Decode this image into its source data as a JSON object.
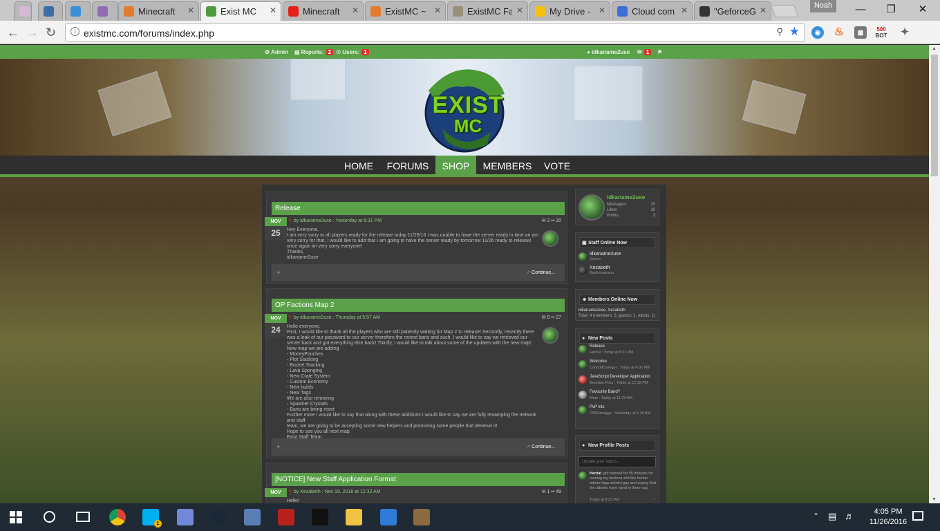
{
  "browser": {
    "tabs": [
      {
        "label": "",
        "icon": "pin-icon",
        "color": "#d7b7d6"
      },
      {
        "label": "",
        "icon": "w-icon",
        "color": "#3d6ea6"
      },
      {
        "label": "",
        "icon": "hex-icon",
        "color": "#3d8fd6"
      },
      {
        "label": "",
        "icon": "mail-icon",
        "color": "#8f6bb4"
      },
      {
        "label": "Minecraft",
        "icon": "m-icon",
        "color": "#e37b2f"
      },
      {
        "label": "Exist MC",
        "icon": "exist-icon",
        "color": "#4f9a3d"
      },
      {
        "label": "Minecraft",
        "icon": "youtube-icon",
        "color": "#e62117"
      },
      {
        "label": "ExistMC ~",
        "icon": "m-icon",
        "color": "#e37b2f"
      },
      {
        "label": "ExistMC Fa",
        "icon": "mcs-icon",
        "color": "#9a8f78"
      },
      {
        "label": "My Drive -",
        "icon": "drive-icon",
        "color": "#f4c20d"
      },
      {
        "label": "Cloud com",
        "icon": "cloud-icon",
        "color": "#3a6fd8"
      },
      {
        "label": "\"GeforceG",
        "icon": "n-icon",
        "color": "#333333"
      }
    ],
    "profile_name": "Noah",
    "url": "existmc.com/forums/index.php"
  },
  "site": {
    "adminbar": {
      "admin": "Admin",
      "reports": "Reports:",
      "reports_count": "2",
      "users": "Users:",
      "users_count": "1",
      "username": "idkaname2use",
      "inbox_count": "1"
    },
    "logo_text_1": "EXIST",
    "logo_text_2": "MC",
    "nav": [
      "HOME",
      "FORUMS",
      "SHOP",
      "MEMBERS",
      "VOTE"
    ],
    "nav_active": "SHOP",
    "threads": [
      {
        "title": "Release",
        "month": "NOV",
        "day": "25",
        "author_line": "by idkaname2use : Yesterday at 8:31 PM",
        "replies": "2",
        "views": "20",
        "body": [
          "Hey Everyone,",
          "I am very sorry to all players ready for the release today 11/25/16 I was unable to have the server ready in time an am",
          "very sorry for that, I would like to add that I am going to have the server ready by tomorrow 11/26 ready to release!",
          "once again im very sorry everyone!",
          "Thanks,",
          "idkaname2use"
        ],
        "continue": "Continue..."
      },
      {
        "title": "OP Factions Map 2",
        "month": "NOV",
        "day": "24",
        "author_line": "by idkaname2use : Thursday at 5:57 AM",
        "replies": "0",
        "views": "27",
        "body": [
          "Hello everyone,",
          "First, I would like to thank all the players who are still patiently waiting for Map 2 to release! Secondly, recently there",
          "was a leak of our password to our server therefore the recent bans and such. I would like to say we retrieved our",
          "server back and got everything else back! Thirdly, I would like to talk about some of the updates with the new map!",
          "New map we are adding",
          "- MoneyPouches",
          "- Plot Stacking",
          "- Bucket Stacking",
          "- Lava Sponging",
          "- New Crate System",
          "- Custom Economy",
          "- New builds",
          "- New Tags",
          "We are also removing",
          "- Spawner Crystals",
          "- Bans are being reset",
          "Further more I would like to say that along with these additions I would like to say we are fully revamping the network and staff",
          "team, we are going to be accepting some new helpers and promoting some people that deserve it!",
          "Hope to see you all next map,",
          "Exist Staff Team"
        ],
        "continue": "Continue..."
      },
      {
        "title": "[NOTICE] New Staff Application Format",
        "month": "NOV",
        "day": "",
        "author_line": "by Xezabeth : Nov 19, 2016 at 12:32 AM",
        "replies": "1",
        "views": "49",
        "body": [
          "Hello!"
        ],
        "continue": ""
      }
    ],
    "sidebar": {
      "user": {
        "name": "idkaname2use",
        "messages_label": "Messages:",
        "messages": "20",
        "likes_label": "Likes:",
        "likes": "10",
        "points_label": "Points:",
        "points": "3"
      },
      "staff_title": "Staff Online Now",
      "staff": [
        {
          "name": "idkaname2use",
          "role": "Owner"
        },
        {
          "name": "Xezabeth",
          "role": "Badministrator"
        }
      ],
      "members_title": "Members Online Now",
      "members_list": "idkaname2use, Xezabeth",
      "members_total": "Total: 4 (members: 2, guests: 1, robots: 1)",
      "newposts_title": "New Posts",
      "new_posts": [
        {
          "title": "Release",
          "meta": "Hentai : Today at 8:21 PM"
        },
        {
          "title": "Welcome",
          "meta": "ConorMcGregor : Today at 4:02 PM"
        },
        {
          "title": "JavaScript Developer Application",
          "meta": "Brandon Foss : Today at 12:32 PM"
        },
        {
          "title": "Favourite Band?",
          "meta": "Marz : Today at 11:23 AM"
        },
        {
          "title": "PvP kits",
          "meta": "OMGitsziggy : Yesterday at 5:18 AM"
        }
      ],
      "profile_title": "New Profile Posts",
      "status_placeholder": "Update your status...",
      "profile_post": {
        "author": "Hentai",
        "text": ": got banned for 55 minutes for naming my factions shit like hentai admin+fags admin+gay and saying that the admins have sand in there vag",
        "time": "Today at 8:23 PM"
      }
    }
  },
  "taskbar": {
    "apps": [
      {
        "name": "chrome",
        "color": "#3d8f3a"
      },
      {
        "name": "skype",
        "color": "#00aff0"
      },
      {
        "name": "discord",
        "color": "#7289da"
      },
      {
        "name": "steam",
        "color": "#1b2838"
      },
      {
        "name": "network",
        "color": "#5a7fb3"
      },
      {
        "name": "filezilla",
        "color": "#b8201e"
      },
      {
        "name": "netflix",
        "color": "#111111"
      },
      {
        "name": "explorer",
        "color": "#f1c343"
      },
      {
        "name": "sync",
        "color": "#2f7bd6"
      },
      {
        "name": "minecraft",
        "color": "#8b6a3f"
      }
    ],
    "skype_badge": "1",
    "time": "4:05 PM",
    "date": "11/26/2016"
  }
}
